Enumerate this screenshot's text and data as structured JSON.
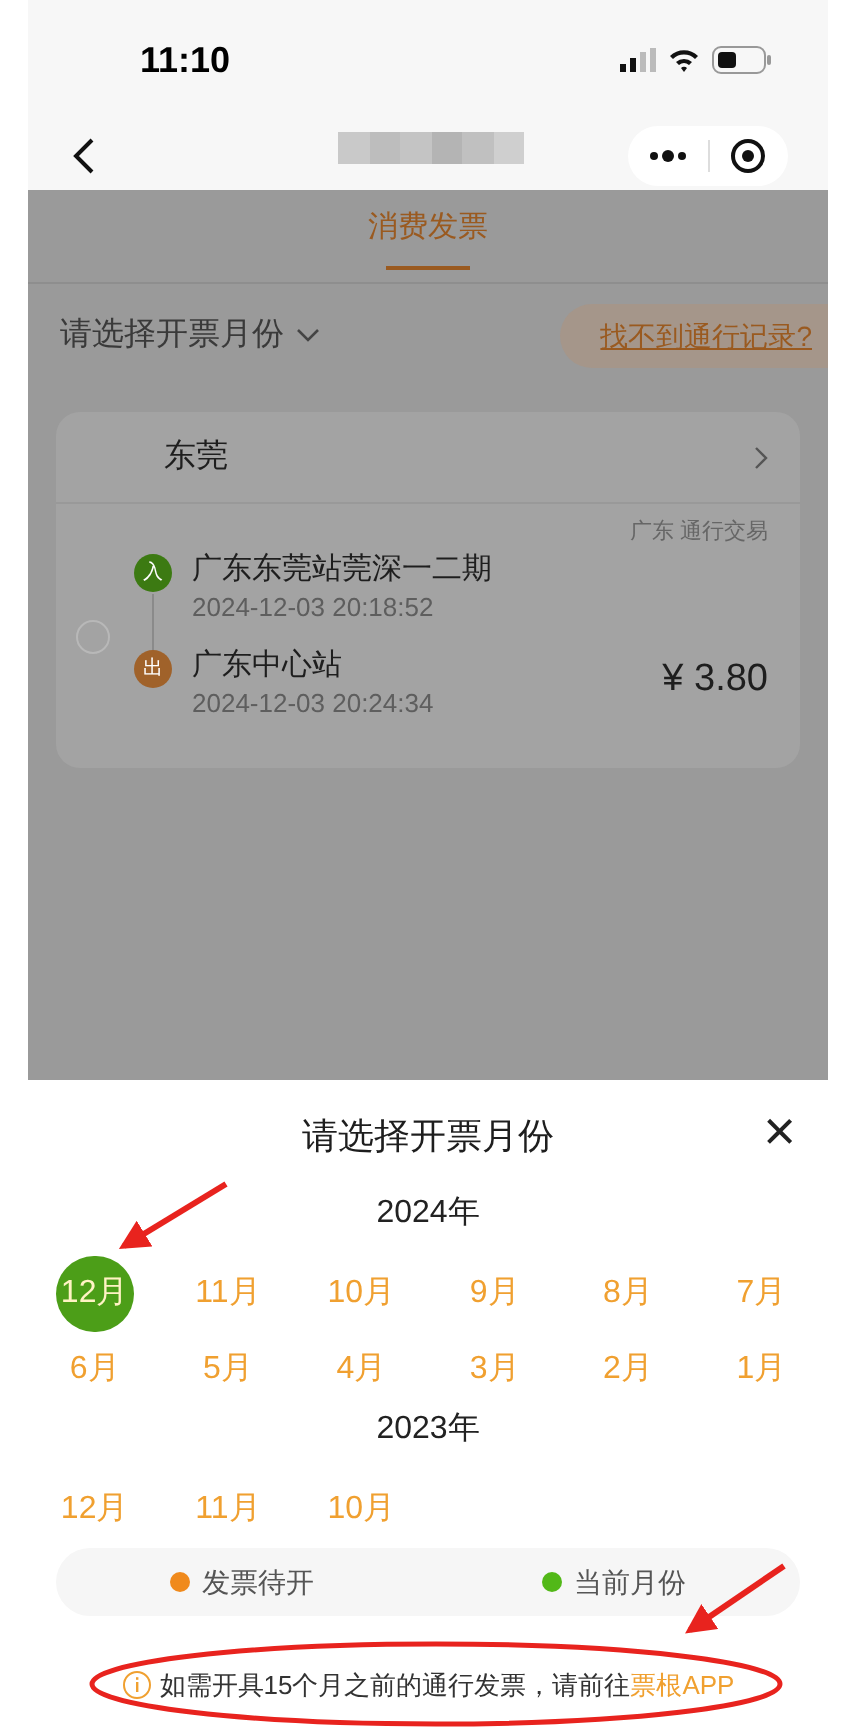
{
  "status_bar": {
    "time": "11:10"
  },
  "tabs": [
    {
      "label": "消费发票",
      "selected": true
    }
  ],
  "filter": {
    "label": "请选择开票月份",
    "link": "找不到通行记录?"
  },
  "record": {
    "city": "东莞",
    "checked": false,
    "tag": "广东 通行交易",
    "amount": "¥ 3.80",
    "stops": [
      {
        "kind": "entry",
        "badge": "入",
        "station": "广东东莞站莞深一二期",
        "time": "2024-12-03 20:18:52"
      },
      {
        "kind": "exit",
        "badge": "出",
        "station": "广东中心站",
        "time": "2024-12-03 20:24:34"
      }
    ]
  },
  "sheet": {
    "title": "请选择开票月份",
    "close": "×",
    "years": [
      {
        "label": "2024年",
        "months": [
          {
            "label": "12月",
            "selected": true
          },
          {
            "label": "11月",
            "selected": false
          },
          {
            "label": "10月",
            "selected": false
          },
          {
            "label": "9月",
            "selected": false
          },
          {
            "label": "8月",
            "selected": false
          },
          {
            "label": "7月",
            "selected": false
          },
          {
            "label": "6月",
            "selected": false
          },
          {
            "label": "5月",
            "selected": false
          },
          {
            "label": "4月",
            "selected": false
          },
          {
            "label": "3月",
            "selected": false
          },
          {
            "label": "2月",
            "selected": false
          },
          {
            "label": "1月",
            "selected": false
          }
        ]
      },
      {
        "label": "2023年",
        "months": [
          {
            "label": "12月",
            "selected": false
          },
          {
            "label": "11月",
            "selected": false
          },
          {
            "label": "10月",
            "selected": false
          }
        ]
      }
    ],
    "legend": [
      {
        "label": "发票待开",
        "color": "#f08a1c"
      },
      {
        "label": "当前月份",
        "color": "#52b818"
      }
    ],
    "note": {
      "text": "如需开具15个月之前的通行发票，请前往",
      "link": "票根APP"
    }
  }
}
